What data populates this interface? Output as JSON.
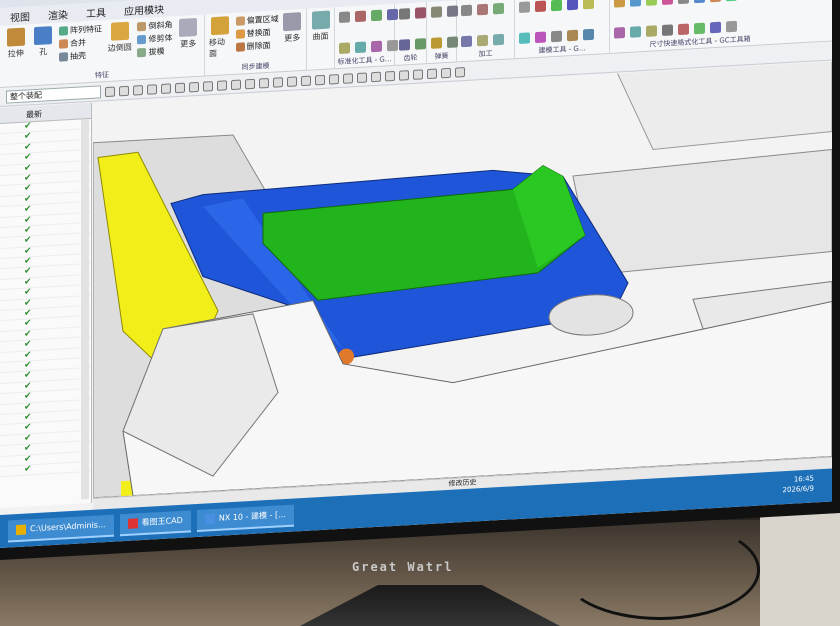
{
  "menu": [
    "视图",
    "渲染",
    "工具",
    "应用模块"
  ],
  "ribbon": {
    "feature": {
      "label": "特征",
      "buttons": [
        "拉伸",
        "孔"
      ],
      "small": [
        "阵列特征",
        "合并",
        "抽壳"
      ],
      "mid": [
        "边倒圆"
      ],
      "right": [
        "倒斜角",
        "修剪体",
        "拔模"
      ],
      "more": "更多"
    },
    "sync": {
      "label": "同步建模",
      "buttons": [
        "移动面"
      ],
      "small": [
        "偏置区域",
        "替换面",
        "删除面"
      ],
      "more": "更多"
    },
    "surface": {
      "label": "曲面",
      "button": "曲面"
    },
    "std_tools": "标准化工具 - G...",
    "gear": "齿轮",
    "spring": "弹簧",
    "machining": "加工",
    "mold_tools": "建模工具 - G...",
    "dim_tools": "尺寸快速格式化工具 - GC工具箱"
  },
  "selection": {
    "filter": "整个装配"
  },
  "navigator": {
    "column": "最新",
    "rows": 34
  },
  "viewport_label": "修改历史",
  "taskbar": {
    "items": [
      "C:\\Users\\Adminis...",
      "看图王CAD",
      "NX 10 - 建模 - [..."
    ],
    "time": "16:45",
    "date": "2026/6/9"
  },
  "monitor_brand": "Great Watrl",
  "colors": {
    "blue_part": "#1f55d8",
    "green_part": "#22b41c",
    "yellow_part": "#f2ee1a",
    "taskbar": "#1d6fb8"
  }
}
